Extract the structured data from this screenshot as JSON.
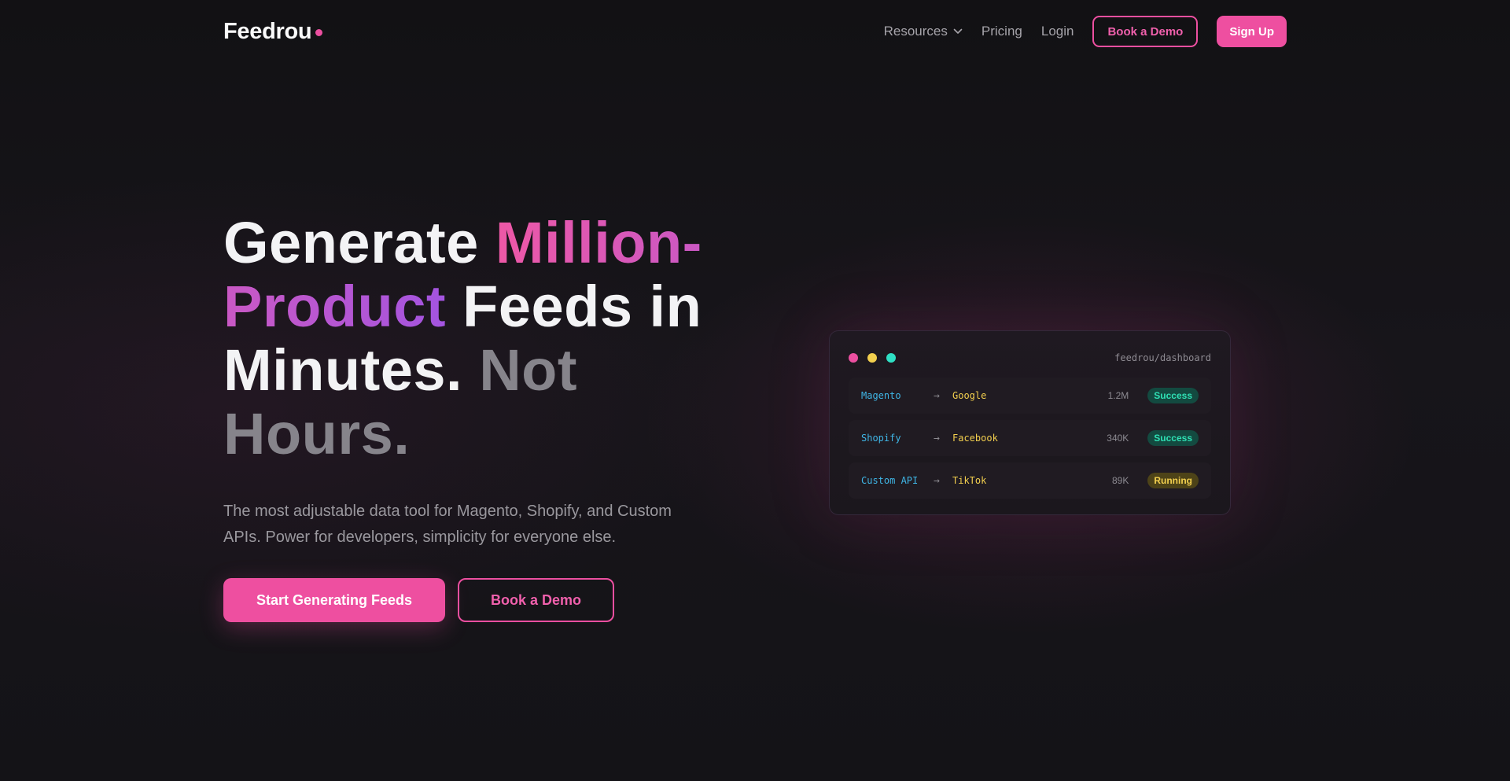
{
  "brand": {
    "name": "Feedrou",
    "dot_color": "#ec4fa0"
  },
  "nav": {
    "resources": "Resources",
    "pricing": "Pricing",
    "login": "Login",
    "book_demo": "Book a Demo",
    "sign_up": "Sign Up"
  },
  "hero": {
    "headline": {
      "part1": "Generate ",
      "highlight": "Million-Product",
      "part2": " Feeds in Minutes. ",
      "muted": "Not Hours."
    },
    "subcopy": "The most adjustable data tool for Magento, Shopify, and Custom APIs. Power for developers, simplicity for everyone else.",
    "cta_primary": "Start Generating Feeds",
    "cta_secondary": "Book a Demo"
  },
  "dashboard": {
    "path": "feedrou/dashboard",
    "window_dots": [
      "#ec4fa0",
      "#f2cf4e",
      "#2fe0c4"
    ],
    "rows": [
      {
        "source": "Magento",
        "arrow": "→",
        "destination": "Google",
        "count": "1.2M",
        "status": "Success"
      },
      {
        "source": "Shopify",
        "arrow": "→",
        "destination": "Facebook",
        "count": "340K",
        "status": "Success"
      },
      {
        "source": "Custom API",
        "arrow": "→",
        "destination": "TikTok",
        "count": "89K",
        "status": "Running"
      }
    ]
  },
  "colors": {
    "accent": "#ee4fa0",
    "background": "#141316",
    "success": "#2fe0b4",
    "running": "#f2cf4e",
    "source_text": "#3fb6e6"
  }
}
